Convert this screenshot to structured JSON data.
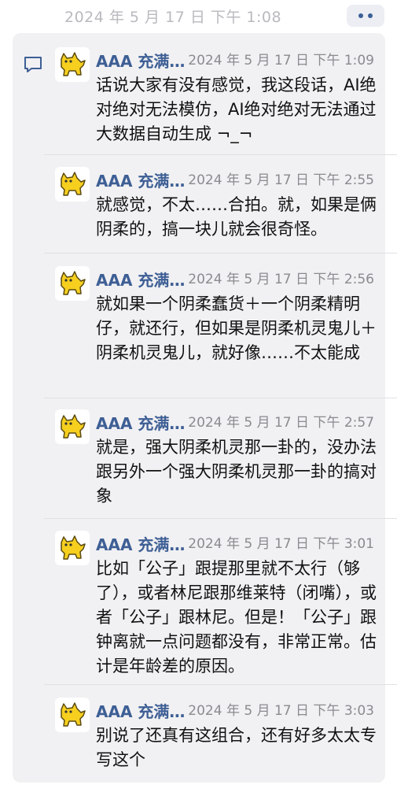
{
  "header": {
    "time": "2024 年 5 月 17 日 下午 1:08"
  },
  "messages": [
    {
      "author": "AAA 充满…",
      "time": "2024 年 5 月 17 日 下午 1:09",
      "text": "话说大家有没有感觉，我这段话，AI绝对绝对无法模仿，AI绝对绝对无法通过大数据自动生成 ¬_¬"
    },
    {
      "author": "AAA 充满…",
      "time": "2024 年 5 月 17 日 下午 2:55",
      "text": "就感觉，不太……合拍。就，如果是俩阴柔的，搞一块儿就会很奇怪。"
    },
    {
      "author": "AAA 充满…",
      "time": "2024 年 5 月 17 日 下午 2:56",
      "text": "就如果一个阴柔蠢货＋一个阴柔精明仔，就还行，但如果是阴柔机灵鬼儿＋阴柔机灵鬼儿，就好像……不太能成"
    },
    {
      "author": "AAA 充满…",
      "time": "2024 年 5 月 17 日 下午 2:57",
      "text": "就是，强大阴柔机灵那一卦的，没办法跟另外一个强大阴柔机灵那一卦的搞对象"
    },
    {
      "author": "AAA 充满…",
      "time": "2024 年 5 月 17 日 下午 3:01",
      "text": "比如「公子」跟提那里就不太行（够了），或者林尼跟那维莱特（闭嘴），或者「公子」跟林尼。但是！「公子」跟钟离就一点问题都没有，非常正常。估计是年龄差的原因。"
    },
    {
      "author": "AAA 充满…",
      "time": "2024 年 5 月 17 日 下午 3:03",
      "text": "别说了还真有这组合，还有好多太太专写这个"
    }
  ]
}
